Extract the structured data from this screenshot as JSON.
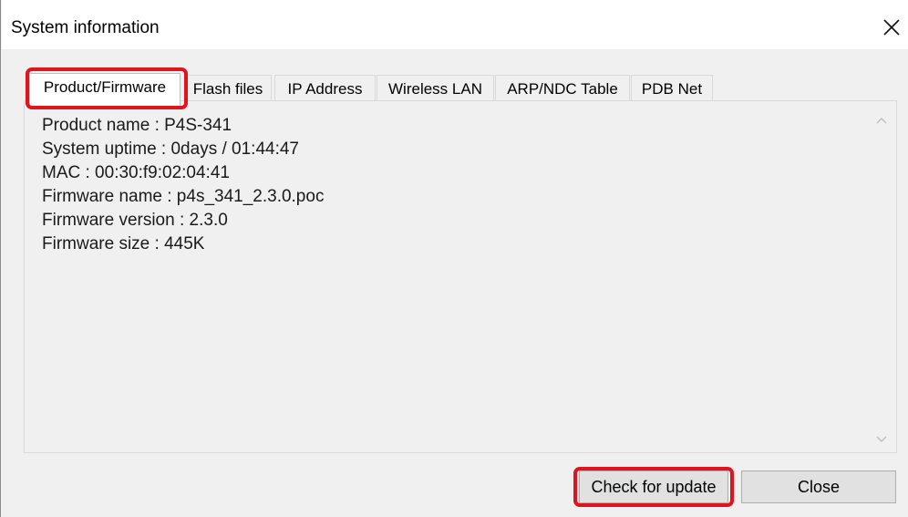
{
  "window": {
    "title": "System information",
    "close_icon": "close-icon"
  },
  "tabs": [
    {
      "label": "Product/Firmware",
      "selected": true
    },
    {
      "label": "Flash files",
      "selected": false
    },
    {
      "label": "IP Address",
      "selected": false
    },
    {
      "label": "Wireless LAN",
      "selected": false
    },
    {
      "label": "ARP/NDC Table",
      "selected": false
    },
    {
      "label": "PDB Net",
      "selected": false
    }
  ],
  "info": {
    "lines": [
      "Product name : P4S-341",
      "System uptime : 0days / 01:44:47",
      "MAC : 00:30:f9:02:04:41",
      "Firmware name : p4s_341_2.3.0.poc",
      "Firmware version : 2.3.0",
      "Firmware size : 445K"
    ]
  },
  "scrollbar": {
    "up_icon": "chevron-up-icon",
    "down_icon": "chevron-down-icon"
  },
  "buttons": {
    "check_update": "Check for update",
    "close": "Close"
  },
  "highlight_color": "#e0141e"
}
